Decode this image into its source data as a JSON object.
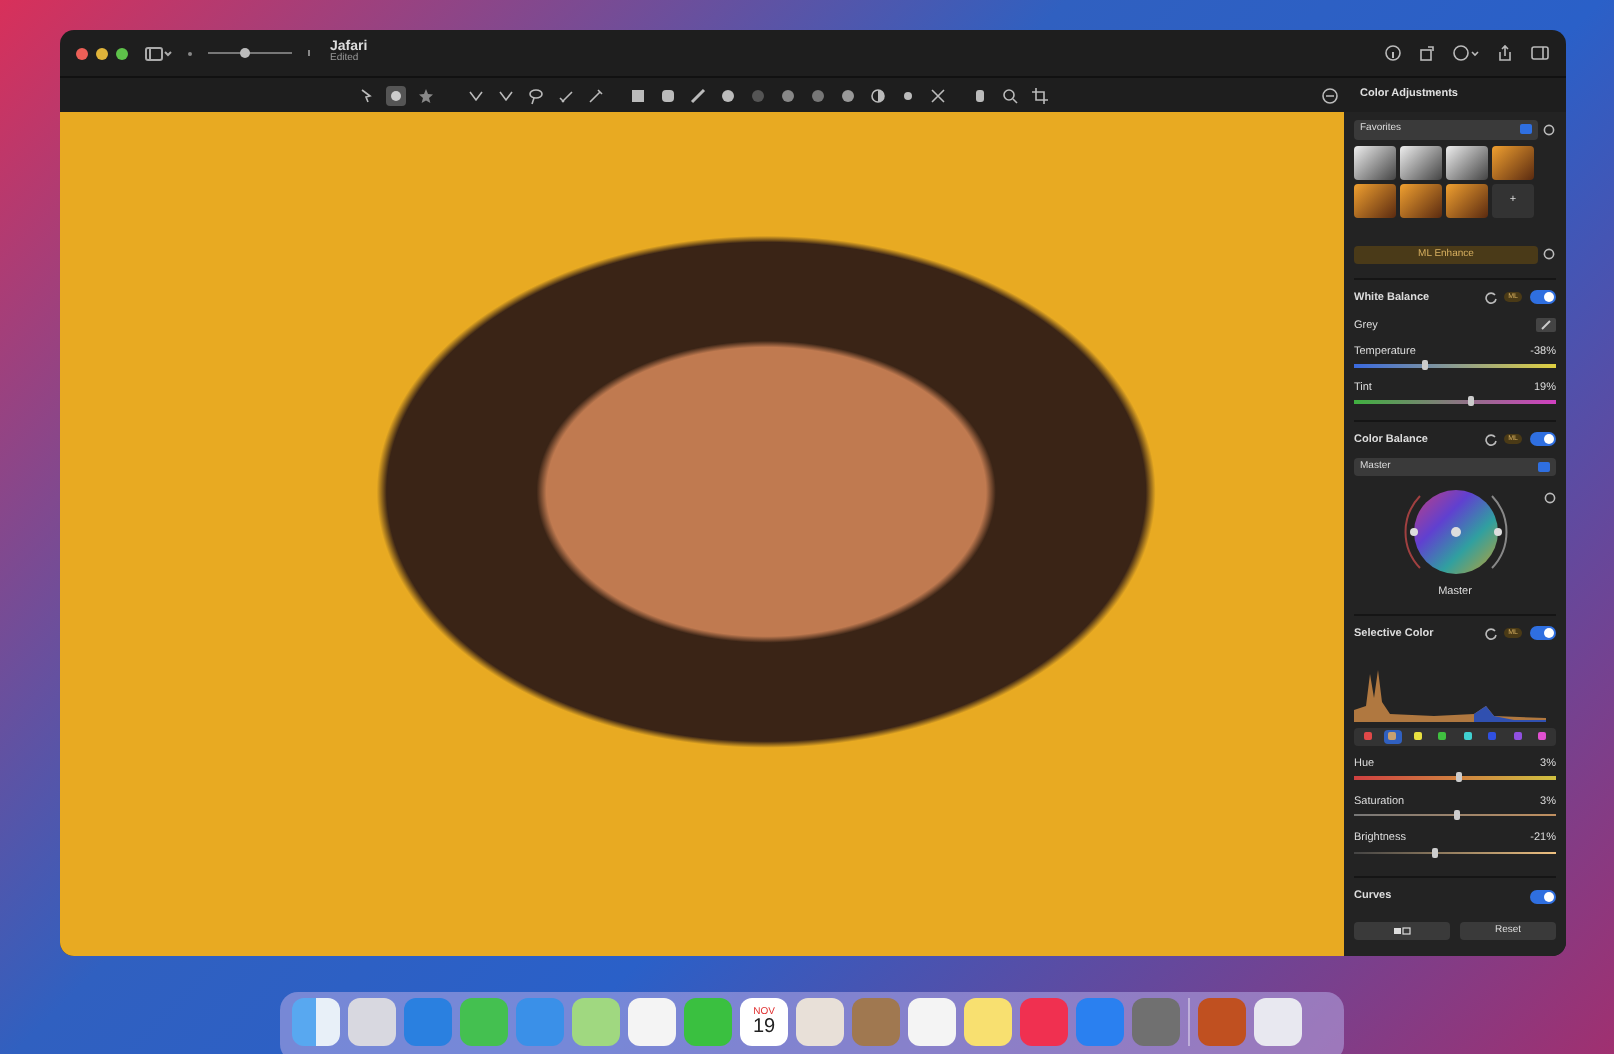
{
  "window": {
    "title": "Jafari",
    "subtitle": "Edited",
    "zoom_slider": {
      "level": 0.45
    }
  },
  "sidebar": {
    "title": "Color Adjustments",
    "preset_menu": "Favorites",
    "presets": [
      {
        "kind": "mono"
      },
      {
        "kind": "mono"
      },
      {
        "kind": "mono"
      },
      {
        "kind": "warm"
      },
      {
        "kind": "warm"
      },
      {
        "kind": "warm"
      },
      {
        "kind": "warm"
      },
      {
        "kind": "add",
        "label": "+"
      }
    ],
    "ml_enhance": "ML Enhance",
    "white_balance": {
      "title": "White Balance",
      "badge": "ML",
      "on": true,
      "grey_label": "Grey",
      "sliders": [
        {
          "label": "Temperature",
          "reading": "-38%",
          "level": 0.35,
          "kind": "temperature"
        },
        {
          "label": "Tint",
          "reading": "19%",
          "level": 0.58,
          "kind": "tint"
        }
      ]
    },
    "color_balance": {
      "title": "Color Balance",
      "badge": "ML",
      "on": true,
      "mode_menu": "Master",
      "wheel_label": "Master"
    },
    "selective_color": {
      "title": "Selective Color",
      "badge": "ML",
      "on": true,
      "swatches": [
        {
          "color": "#e04848",
          "selected": false
        },
        {
          "color": "#c8a070",
          "selected": true
        },
        {
          "color": "#e8e040",
          "selected": false
        },
        {
          "color": "#40c040",
          "selected": false
        },
        {
          "color": "#40d0d0",
          "selected": false
        },
        {
          "color": "#3050e0",
          "selected": false
        },
        {
          "color": "#9050e0",
          "selected": false
        },
        {
          "color": "#e050d0",
          "selected": false
        }
      ],
      "sliders": [
        {
          "label": "Hue",
          "reading": "3%",
          "level": 0.52,
          "kind": "hue"
        },
        {
          "label": "Saturation",
          "reading": "3%",
          "level": 0.51,
          "kind": "saturation"
        },
        {
          "label": "Brightness",
          "reading": "-21%",
          "level": 0.4,
          "kind": "brightness"
        }
      ]
    },
    "curves": {
      "title": "Curves",
      "on": true
    },
    "reset_button": "Reset"
  },
  "dock": {
    "calendar_month": "NOV",
    "calendar_day": "19"
  }
}
